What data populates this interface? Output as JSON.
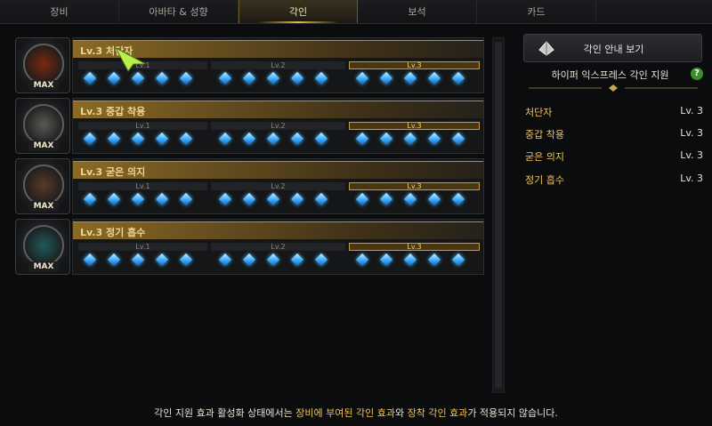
{
  "tabs": [
    {
      "label": "장비",
      "active": false
    },
    {
      "label": "아바타 & 성향",
      "active": false
    },
    {
      "label": "각인",
      "active": true
    },
    {
      "label": "보석",
      "active": false
    },
    {
      "label": "카드",
      "active": false
    }
  ],
  "engravings": [
    {
      "title": "Lv.3 처단자",
      "name": "처단자",
      "levels": [
        "Lv.1",
        "Lv.2",
        "Lv.3"
      ],
      "active_level": 3,
      "badge": "MAX"
    },
    {
      "title": "Lv.3 중갑 착용",
      "name": "중갑 착용",
      "levels": [
        "Lv.1",
        "Lv.2",
        "Lv.3"
      ],
      "active_level": 3,
      "badge": "MAX"
    },
    {
      "title": "Lv.3 굳은 의지",
      "name": "굳은 의지",
      "levels": [
        "Lv.1",
        "Lv.2",
        "Lv.3"
      ],
      "active_level": 3,
      "badge": "MAX"
    },
    {
      "title": "Lv.3 정기 흡수",
      "name": "정기 흡수",
      "levels": [
        "Lv.1",
        "Lv.2",
        "Lv.3"
      ],
      "active_level": 3,
      "badge": "MAX"
    }
  ],
  "guide": {
    "button_label": "각인 안내 보기",
    "hyper_title": "하이퍼 익스프레스 각인 지원",
    "help": "?"
  },
  "effects": [
    {
      "name": "처단자",
      "level": "Lv. 3"
    },
    {
      "name": "중갑 착용",
      "level": "Lv. 3"
    },
    {
      "name": "굳은 의지",
      "level": "Lv. 3"
    },
    {
      "name": "정기 흡수",
      "level": "Lv. 3"
    }
  ],
  "footer": {
    "part1": "각인 지원 효과 활성화 상태에서는 ",
    "hl1": "장비에 부여된 각인 효과",
    "part2": "와 ",
    "hl2": "장착 각인 효과",
    "part3": "가 적용되지 않습니다."
  },
  "colors": {
    "accent": "#f0c35a",
    "gem": "#3aa9ff",
    "title_gold": "#8a6a25"
  }
}
